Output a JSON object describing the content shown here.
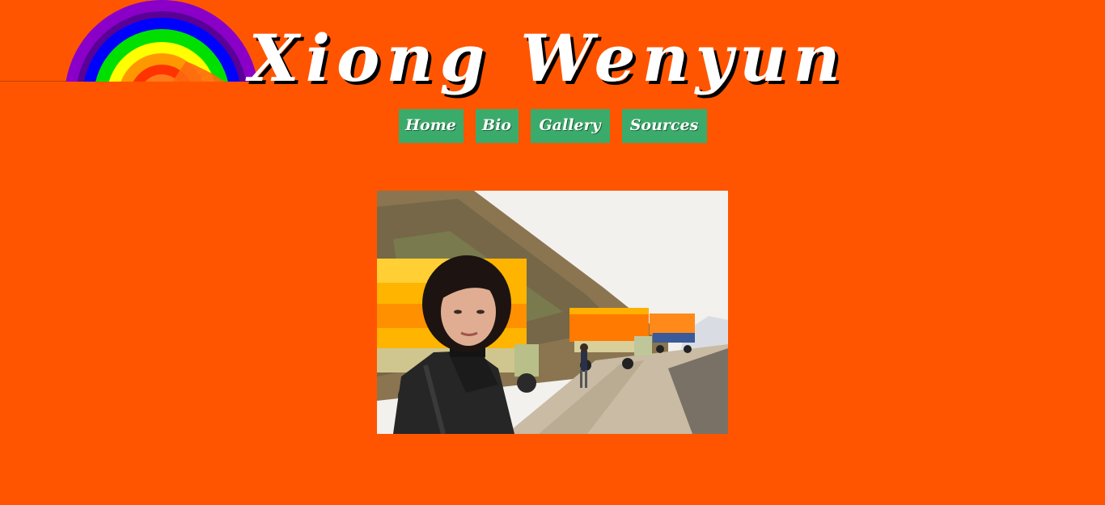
{
  "site": {
    "title": "Xiong Wenyun"
  },
  "nav": {
    "items": [
      {
        "label": "Home"
      },
      {
        "label": "Bio"
      },
      {
        "label": "Gallery"
      },
      {
        "label": "Sources"
      }
    ]
  },
  "colors": {
    "background": "#ff5500",
    "nav_button": "#3bab6b",
    "title_text": "#ffffff",
    "title_shadow": "#000000"
  },
  "icons": {
    "logo": "rainbow-logo"
  }
}
